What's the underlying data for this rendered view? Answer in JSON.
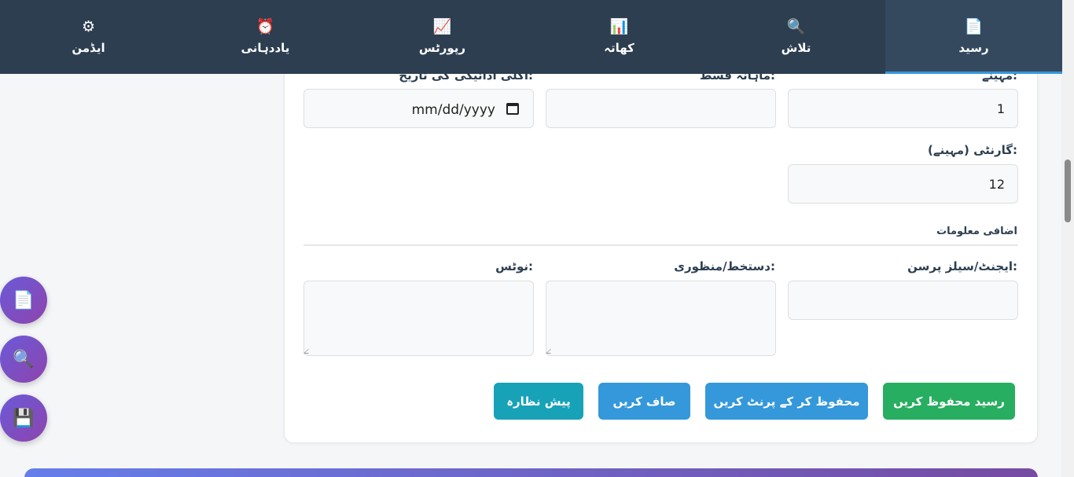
{
  "nav": {
    "items": [
      {
        "label": "رسید",
        "icon": "📄",
        "icon_name": "receipt-icon"
      },
      {
        "label": "تلاش",
        "icon": "🔍",
        "icon_name": "search-icon"
      },
      {
        "label": "کھاتہ",
        "icon": "📊",
        "icon_name": "ledger-chart-icon"
      },
      {
        "label": "رپورٹس",
        "icon": "📈",
        "icon_name": "reports-chart-icon"
      },
      {
        "label": "یاددہانی",
        "icon": "⏰",
        "icon_name": "alarm-clock-icon"
      },
      {
        "label": "ایڈمن",
        "icon": "⚙",
        "icon_name": "gear-icon"
      }
    ],
    "active_index": 0,
    "colors": {
      "background": "#2c3e50",
      "active": "#34495e",
      "accent": "#3498db"
    }
  },
  "form": {
    "months_label": "مہینے:",
    "months_value": "1",
    "installment_label": "ماہانہ قسط:",
    "installment_value": "",
    "next_payment_label": "اگلی ادائیگی کی تاریخ:",
    "next_payment_placeholder": "mm/dd/yyyy",
    "guarantee_label": "گارنٹی (مہینے):",
    "guarantee_value": "12",
    "extra_section_title": "اضافی معلومات",
    "agent_label": "ایجنٹ/سیلز پرسن:",
    "agent_value": "",
    "signature_label": "دستخط/منظوری:",
    "notes_label": "نوٹس:"
  },
  "actions": {
    "save_receipt": "رسید محفوظ کریں",
    "save_print": "محفوظ کر کے پرنٹ کریں",
    "clear": "صاف کریں",
    "preview": "پیش نظارہ",
    "colors": {
      "save": "#27ae60",
      "print": "#3498db",
      "clear": "#3498db",
      "preview": "#17a2b8"
    }
  },
  "fabs": [
    {
      "icon": "📄",
      "icon_name": "document-icon"
    },
    {
      "icon": "🔍",
      "icon_name": "magnifier-icon"
    },
    {
      "icon": "💾",
      "icon_name": "floppy-disk-icon"
    }
  ]
}
